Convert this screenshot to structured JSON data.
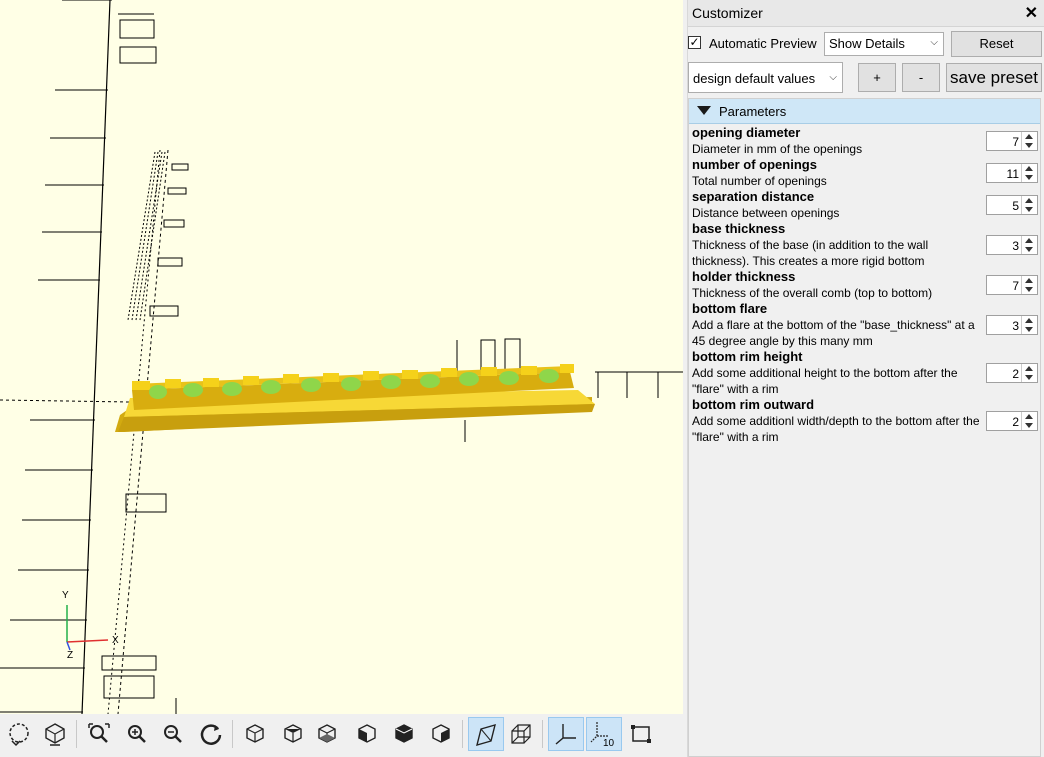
{
  "viewport": {
    "axis_labels": {
      "y": "Y",
      "x": "X",
      "z": "Z"
    },
    "model_color": "#f5d11a",
    "background_color": "#ffffe6"
  },
  "toolbar": {
    "buttons": [
      {
        "name": "preview-icon"
      },
      {
        "name": "render-icon"
      },
      {
        "name": "view-all-icon"
      },
      {
        "name": "zoom-in-icon"
      },
      {
        "name": "zoom-out-icon"
      },
      {
        "name": "reset-view-icon"
      },
      {
        "name": "view-right-icon"
      },
      {
        "name": "view-top-icon"
      },
      {
        "name": "view-bottom-icon"
      },
      {
        "name": "view-left-icon"
      },
      {
        "name": "view-front-icon"
      },
      {
        "name": "view-back-icon"
      },
      {
        "name": "perspective-icon"
      },
      {
        "name": "orthogonal-icon"
      },
      {
        "name": "show-axes-icon"
      },
      {
        "name": "show-scale-markers-icon"
      },
      {
        "name": "show-edges-icon"
      }
    ],
    "scale_label": "10"
  },
  "customizer": {
    "title": "Customizer",
    "close_glyph": "✕",
    "auto_preview_label": "Automatic Preview",
    "auto_preview_checked": true,
    "check_glyph": "✓",
    "details_value": "Show Details",
    "reset_label": "Reset",
    "preset_value": "design default values",
    "plus_label": "+",
    "minus_label": "-",
    "save_preset_label": "save preset",
    "section_label": "Parameters",
    "params": [
      {
        "name": "opening diameter",
        "desc": "Diameter in mm of the openings",
        "value": "7"
      },
      {
        "name": "number of openings",
        "desc": "Total number of openings",
        "value": "11"
      },
      {
        "name": "separation distance",
        "desc": "Distance between openings",
        "value": "5"
      },
      {
        "name": "base thickness",
        "desc": "Thickness of the base (in addition to the wall thickness). This creates a more rigid bottom",
        "value": "3"
      },
      {
        "name": "holder thickness",
        "desc": "Thickness of the overall comb (top to bottom)",
        "value": "7"
      },
      {
        "name": "bottom flare",
        "desc": "Add a flare at the bottom of the \"base_thickness\" at a 45 degree angle by this many mm",
        "value": "3"
      },
      {
        "name": "bottom rim height",
        "desc": "Add some additional height to the bottom after the \"flare\" with a rim",
        "value": "2"
      },
      {
        "name": "bottom rim outward",
        "desc": "Add some additionl width/depth to the bottom after the \"flare\" with a rim",
        "value": "2"
      }
    ]
  }
}
